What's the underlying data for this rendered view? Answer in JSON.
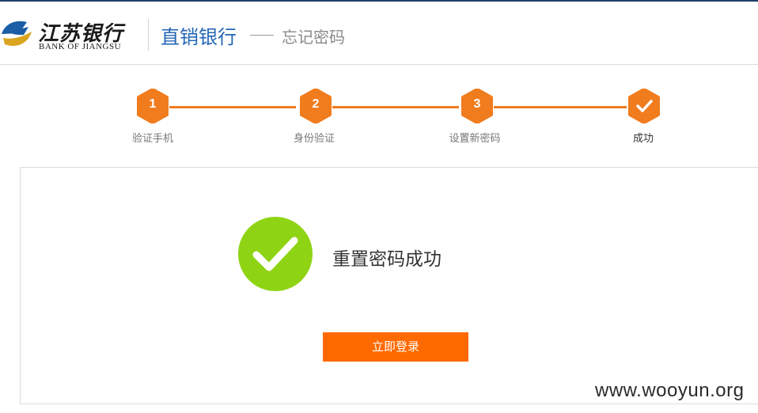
{
  "header": {
    "logo_cn": "江苏银行",
    "logo_en": "BANK OF JIANGSU",
    "logo_icon": "bank-of-jiangsu-logo-icon",
    "product_title": "直销银行",
    "page_subtitle": "忘记密码"
  },
  "steps": [
    {
      "number": "1",
      "label": "验证手机"
    },
    {
      "number": "2",
      "label": "身份验证"
    },
    {
      "number": "3",
      "label": "设置新密码"
    },
    {
      "number": "",
      "icon": "check-icon",
      "label": "成功"
    }
  ],
  "result": {
    "icon": "success-check-icon",
    "message": "重置密码成功",
    "button_label": "立即登录"
  },
  "watermark": "www.wooyun.org",
  "colors": {
    "step_orange": "#f07c1e",
    "button_orange": "#ff6a00",
    "success_green": "#8fd414",
    "brand_blue": "#2366b5"
  }
}
